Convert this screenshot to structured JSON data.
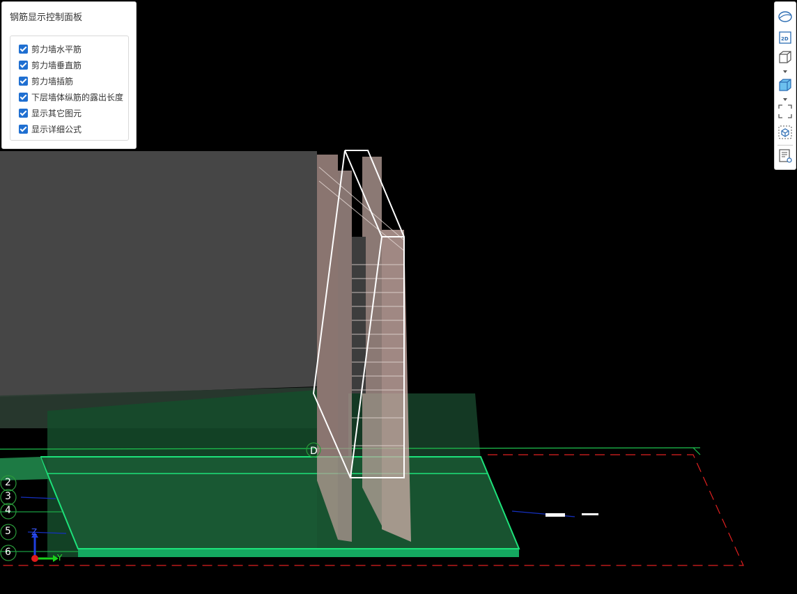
{
  "panel": {
    "title": "钢筋显示控制面板",
    "options": [
      {
        "label": "剪力墙水平筋",
        "checked": true
      },
      {
        "label": "剪力墙垂直筋",
        "checked": true
      },
      {
        "label": "剪力墙插筋",
        "checked": true
      },
      {
        "label": "下层墙体纵筋的露出长度",
        "checked": true
      },
      {
        "label": "显示其它图元",
        "checked": true
      },
      {
        "label": "显示详细公式",
        "checked": true
      }
    ]
  },
  "toolbar": {
    "items": [
      "orbit-icon",
      "2d-view-icon",
      "wireframe-box-icon",
      "solid-box-icon",
      "fit-view-icon",
      "isolate-icon",
      "list-view-icon"
    ],
    "label_2d": "2D"
  },
  "scene": {
    "axis_labels": [
      "2",
      "3",
      "4",
      "5",
      "6"
    ],
    "grid_marker": "D",
    "gizmo": {
      "z": "Z",
      "y": "Y"
    },
    "colors": {
      "background": "#000000",
      "slab": "#1a6b3a",
      "slab_edge": "#1de27a",
      "wall": "#4a4a4a",
      "rebar": "#c8a8a0",
      "selection": "#ffffff",
      "boundary": "#e02020",
      "axis_circle": "#2a9a3a"
    }
  }
}
